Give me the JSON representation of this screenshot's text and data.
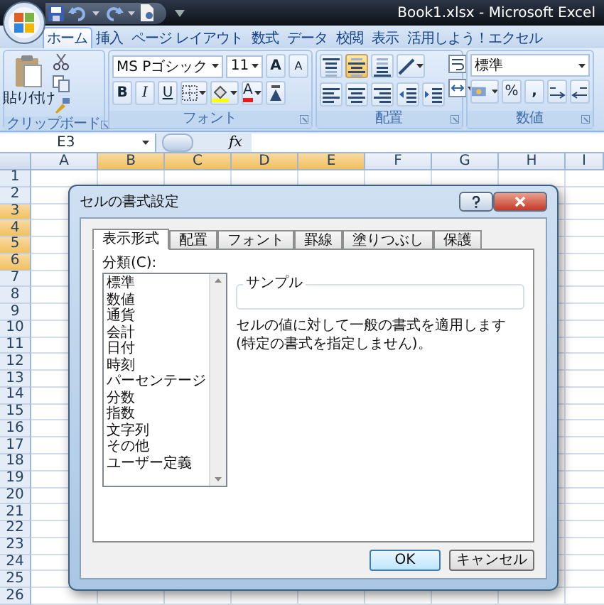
{
  "title_bar": {
    "title": "Book1.xlsx - Microsoft Excel"
  },
  "ribbon_tabs": [
    {
      "label": "ホーム",
      "selected": true
    },
    {
      "label": "挿入",
      "selected": false
    },
    {
      "label": "ページ レイアウト",
      "selected": false
    },
    {
      "label": "数式",
      "selected": false
    },
    {
      "label": "データ",
      "selected": false
    },
    {
      "label": "校閲",
      "selected": false
    },
    {
      "label": "表示",
      "selected": false
    },
    {
      "label": "活用しよう！エクセル",
      "selected": false
    }
  ],
  "clipboard": {
    "label": "クリップボード",
    "paste": "貼り付け"
  },
  "font": {
    "label": "フォント",
    "font_name": "MS Pゴシック",
    "font_size": "11",
    "grow": "A",
    "shrink": "A",
    "bold": "B",
    "italic": "I",
    "underline": "U",
    "font_color": "A"
  },
  "alignment": {
    "label": "配置",
    "top_buttons": [
      {
        "kind": "align-top",
        "selected": false
      },
      {
        "kind": "align-middle",
        "selected": true
      },
      {
        "kind": "align-bottom",
        "selected": false
      }
    ],
    "bottom_buttons": [
      {
        "kind": "align-left",
        "selected": false
      },
      {
        "kind": "align-center",
        "selected": false
      },
      {
        "kind": "align-right",
        "selected": false
      },
      {
        "kind": "indent-decrease",
        "selected": false
      },
      {
        "kind": "indent-increase",
        "selected": false
      }
    ]
  },
  "number": {
    "label": "数値",
    "format": "標準",
    "percent": "%",
    "comma": ","
  },
  "formula_bar": {
    "name_box": "E3",
    "function": "fx"
  },
  "columns": [
    {
      "label": "A",
      "selected": false
    },
    {
      "label": "B",
      "selected": true
    },
    {
      "label": "C",
      "selected": true
    },
    {
      "label": "D",
      "selected": true
    },
    {
      "label": "E",
      "selected": true
    },
    {
      "label": "F",
      "selected": false
    },
    {
      "label": "G",
      "selected": false
    },
    {
      "label": "H",
      "selected": false
    },
    {
      "label": "I",
      "selected": false
    }
  ],
  "rows": [
    {
      "label": "1",
      "selected": false
    },
    {
      "label": "2",
      "selected": false
    },
    {
      "label": "3",
      "selected": true
    },
    {
      "label": "4",
      "selected": true
    },
    {
      "label": "5",
      "selected": true
    },
    {
      "label": "6",
      "selected": true
    },
    {
      "label": "7",
      "selected": false
    },
    {
      "label": "8",
      "selected": false
    },
    {
      "label": "9",
      "selected": false
    },
    {
      "label": "10",
      "selected": false
    },
    {
      "label": "11",
      "selected": false
    },
    {
      "label": "12",
      "selected": false
    },
    {
      "label": "13",
      "selected": false
    },
    {
      "label": "14",
      "selected": false
    },
    {
      "label": "15",
      "selected": false
    },
    {
      "label": "16",
      "selected": false
    },
    {
      "label": "17",
      "selected": false
    },
    {
      "label": "18",
      "selected": false
    },
    {
      "label": "19",
      "selected": false
    },
    {
      "label": "20",
      "selected": false
    },
    {
      "label": "21",
      "selected": false
    },
    {
      "label": "22",
      "selected": false
    },
    {
      "label": "23",
      "selected": false
    },
    {
      "label": "24",
      "selected": false
    },
    {
      "label": "25",
      "selected": false
    },
    {
      "label": "26",
      "selected": false
    }
  ],
  "dialog": {
    "title": "セルの書式設定",
    "tabs": [
      {
        "label": "表示形式",
        "selected": true
      },
      {
        "label": "配置",
        "selected": false
      },
      {
        "label": "フォント",
        "selected": false
      },
      {
        "label": "罫線",
        "selected": false
      },
      {
        "label": "塗りつぶし",
        "selected": false
      },
      {
        "label": "保護",
        "selected": false
      }
    ],
    "category_label": "分類(C):",
    "categories": [
      "標準",
      "数値",
      "通貨",
      "会計",
      "日付",
      "時刻",
      "パーセンテージ",
      "分数",
      "指数",
      "文字列",
      "その他",
      "ユーザー定義"
    ],
    "sample_label": "サンプル",
    "description": "セルの値に対して一般の書式を適用します (特定の書式を指定しません)。",
    "buttons": [
      {
        "label": "OK",
        "default": true
      },
      {
        "label": "キャンセル",
        "default": false
      }
    ]
  }
}
